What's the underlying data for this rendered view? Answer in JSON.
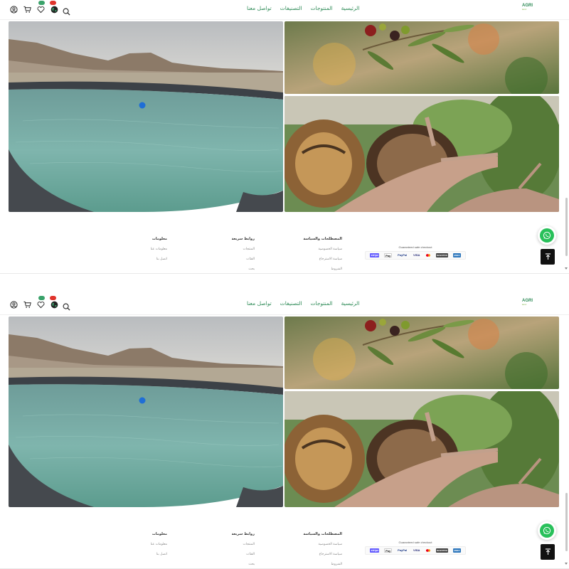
{
  "header": {
    "nav": [
      "الرئيسية",
      "المنتوجات",
      "التصنيفات",
      "تواصل معنا"
    ],
    "logo_main": "AGRI",
    "logo_sub": "kénz",
    "icons": [
      "user-icon",
      "cart-icon",
      "heart-icon",
      "globe-icon",
      "search-icon"
    ]
  },
  "footer": {
    "columns": [
      {
        "title": "معلومات",
        "links": [
          "معلومات عنا",
          "اتصل بنا"
        ]
      },
      {
        "title": "روابط سريعة",
        "links": [
          "المنتجات",
          "الفئات",
          "بحث"
        ]
      },
      {
        "title": "المصطلحات والسياسة",
        "links": [
          "سياسة الخصوصية",
          "سياسة الاسترجاع",
          "الشروط"
        ]
      }
    ],
    "payments_title": "Guaranteed safe checkout",
    "payment_methods": [
      "stripe",
      "Pay",
      "PayPal",
      "VISA",
      "mastercard",
      "MAESTRO",
      "AMEX"
    ]
  },
  "colors": {
    "accent": "#2e8b57",
    "whatsapp": "#28c05a",
    "badge_green": "#3aa26a",
    "badge_red": "#e0342c"
  }
}
